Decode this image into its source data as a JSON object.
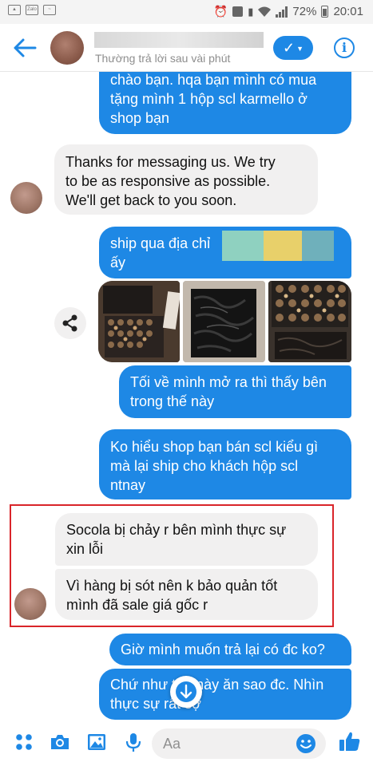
{
  "status_bar": {
    "left_icons": [
      "image-icon",
      "zalo-icon",
      "activity-icon"
    ],
    "zalo_label": "Zalo",
    "right_icons": [
      "alarm-icon",
      "storage-icon",
      "vibrate-icon",
      "wifi-icon",
      "signal-icon"
    ],
    "battery": "72%",
    "time": "20:01"
  },
  "header": {
    "status": "Thường trả lời sau vài phút",
    "colors": {
      "accent": "#1e88e5"
    }
  },
  "messages": [
    {
      "sender": "me",
      "lines": [
        "chào bạn. hqa bạn mình có mua",
        "tặng mình 1 hộp scl karmello ở",
        "shop bạn"
      ]
    },
    {
      "sender": "them",
      "lines": [
        "Thanks for messaging us. We try",
        "to be as responsive as possible.",
        "We'll get back to you soon."
      ]
    },
    {
      "sender": "me",
      "lines": [
        "ship qua địa chỉ",
        "ấy"
      ]
    },
    {
      "sender": "me",
      "type": "photos",
      "count": 3
    },
    {
      "sender": "me",
      "lines": [
        "Tối về mình mở ra thì thấy bên",
        "trong thế này"
      ]
    },
    {
      "sender": "me",
      "lines": [
        "Ko hiểu shop bạn bán scl kiểu gì",
        "mà lại ship cho khách hộp scl",
        "ntnay"
      ]
    },
    {
      "sender": "them",
      "lines": [
        "Socola bị chảy r bên mình thực sự",
        "xin lỗi"
      ]
    },
    {
      "sender": "them",
      "lines": [
        "Vì hàng bị sót nên k bảo quản tốt",
        "mình đã sale giá gốc r"
      ]
    },
    {
      "sender": "me",
      "lines": [
        "Giờ mình muốn trả lại có đc ko?"
      ]
    },
    {
      "sender": "me",
      "lines": [
        "Chứ như thế này ăn sao đc. Nhìn",
        "thực sự rất sợ"
      ]
    }
  ],
  "composer": {
    "placeholder": "Aa",
    "icons": [
      "apps-icon",
      "camera-icon",
      "gallery-icon",
      "microphone-icon",
      "emoji-icon",
      "thumbs-up-icon"
    ]
  },
  "colors": {
    "outgoing_bubble": "#1e88e5",
    "incoming_bubble": "#f1f0f0",
    "highlight_border": "#d9252a"
  }
}
